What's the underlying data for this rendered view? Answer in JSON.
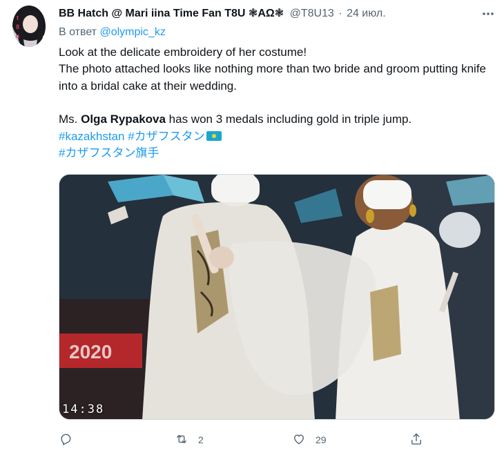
{
  "author": {
    "display_name": "BB Hatch @ Mari iina Time Fan T8U ❃ΑΩ❃",
    "handle": "@T8U13",
    "separator": "·",
    "date": "24 июл.",
    "avatar_tag": "t8u"
  },
  "reply_to": {
    "prefix": "В ответ ",
    "mention": "@olympic_kz"
  },
  "text": {
    "line1": "Look at the delicate embroidery of her costume!",
    "line2": "The photo attached looks like nothing more than two bride and groom putting knife into a bridal cake at their wedding.",
    "line3_pre": "Ms. ",
    "line3_bold": "Olga Rypakova",
    "line3_post": " has won 3 medals including gold in triple jump.",
    "hashtag1": "#kazakhstan",
    "hashtag2": "#カザフスタン",
    "hashtag3": "#カザフスタン旗手"
  },
  "media": {
    "timestamp": "14:38",
    "banner_text": "2020"
  },
  "actions": {
    "reply_count": "",
    "retweet_count": "2",
    "like_count": "29",
    "share_count": ""
  },
  "icons": {
    "more": "more-icon",
    "reply": "reply-icon",
    "retweet": "retweet-icon",
    "like": "heart-icon",
    "share": "share-icon"
  },
  "colors": {
    "link": "#1d9bf0",
    "secondary_text": "#536471",
    "primary_text": "#0f1419"
  }
}
